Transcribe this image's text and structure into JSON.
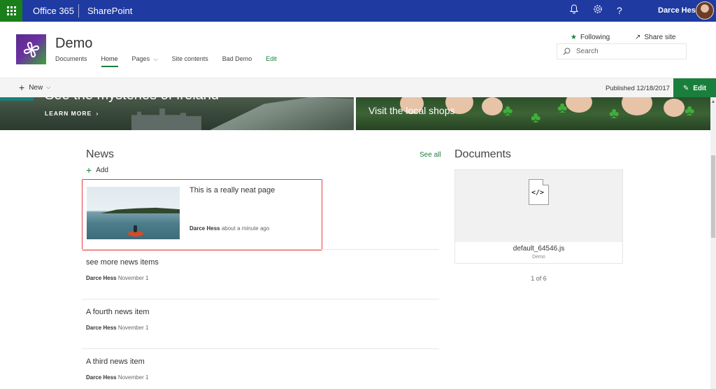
{
  "suite_bar": {
    "brand": "Office 365",
    "app": "SharePoint",
    "user_name": "Darce Hess",
    "colors": {
      "bar": "#1f3aa0",
      "waffle": "#1a7f1a"
    },
    "icons": [
      "waffle-icon",
      "bell-icon",
      "gear-icon",
      "help-icon"
    ]
  },
  "site": {
    "title": "Demo",
    "nav": [
      {
        "label": "Documents"
      },
      {
        "label": "Home"
      },
      {
        "label": "Pages"
      },
      {
        "label": "Site contents"
      },
      {
        "label": "Bad Demo"
      },
      {
        "label": "Edit"
      }
    ],
    "following_label": "Following",
    "share_label": "Share site",
    "search_placeholder": "Search"
  },
  "command_bar": {
    "new_label": "New",
    "published": "Published 12/18/2017",
    "edit_label": "Edit",
    "accent": "#1a7f3c"
  },
  "hero": {
    "left_title_partial": "See the mysteries of Ireland",
    "learn_more": "LEARN MORE",
    "right_caption": "Visit the local shops"
  },
  "news": {
    "title": "News",
    "see_all": "See all",
    "add_label": "Add",
    "featured": {
      "headline": "This is a really neat page",
      "author": "Darce Hess",
      "time": "about a minute ago"
    },
    "items": [
      {
        "title": "see more news items",
        "author": "Darce Hess",
        "date": "November 1"
      },
      {
        "title": "A fourth news item",
        "author": "Darce Hess",
        "date": "November 1"
      },
      {
        "title": "A third news item",
        "author": "Darce Hess",
        "date": "November 1"
      }
    ]
  },
  "documents": {
    "title": "Documents",
    "file_name": "default_64546.js",
    "file_location": "Demo",
    "pager": "1 of 6",
    "file_icon": "code-file-icon"
  }
}
